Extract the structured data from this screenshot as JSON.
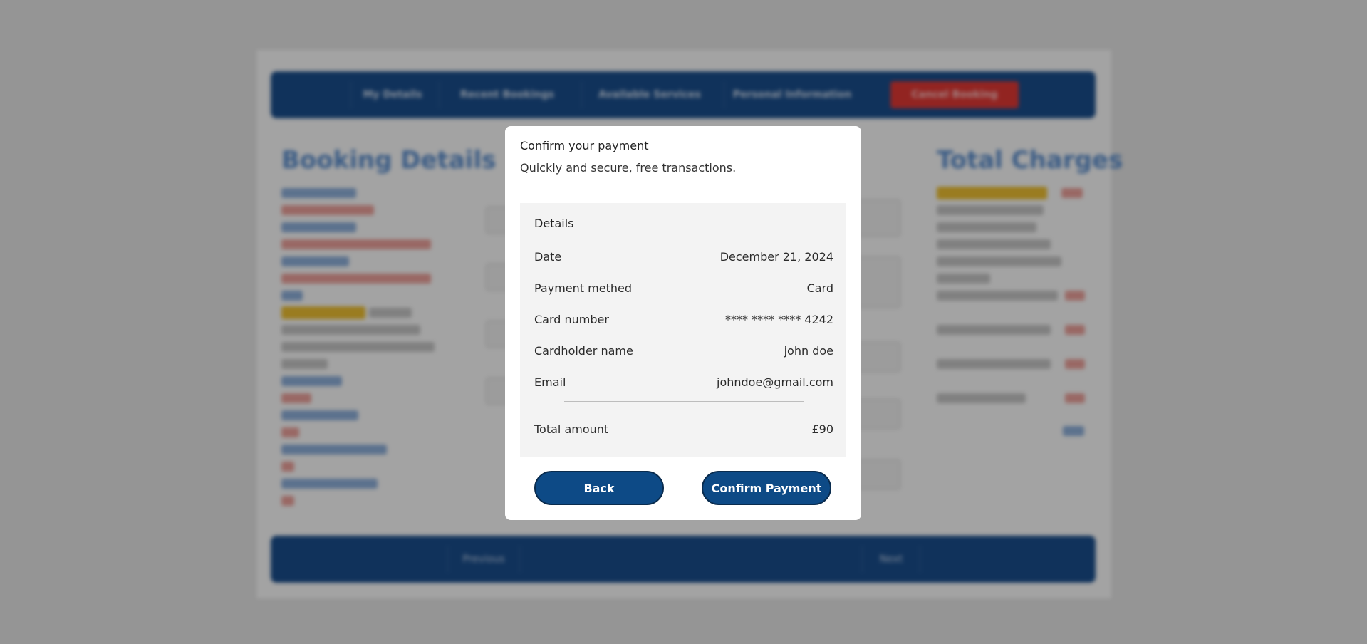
{
  "background_page": {
    "nav_items": [
      "My Details",
      "Recent Bookings",
      "Available Services",
      "Personal Information",
      "Cancel Booking"
    ],
    "columns": {
      "booking_title": "Booking Details",
      "total_title": "Total Charges"
    },
    "footer": {
      "previous_label": "Previous",
      "next_label": "Next"
    }
  },
  "modal": {
    "title": "Confirm your payment",
    "subtitle": "Quickly and secure, free transactions.",
    "details_heading": "Details",
    "rows": [
      {
        "label": "Date",
        "value": "December 21, 2024"
      },
      {
        "label": "Payment methed",
        "value": "Card"
      },
      {
        "label": "Card number",
        "value": "**** **** **** 4242"
      },
      {
        "label": "Cardholder name",
        "value": "john doe"
      },
      {
        "label": "Email",
        "value": "johndoe@gmail.com"
      }
    ],
    "total": {
      "label": "Total amount",
      "value": "£90"
    },
    "back_label": "Back",
    "confirm_label": "Confirm Payment"
  },
  "colors": {
    "primary_button": "#0d4a86",
    "overlay": "rgba(0,0,0,0.36)",
    "nav_bar": "#1a4f8f",
    "danger": "#e53935"
  }
}
